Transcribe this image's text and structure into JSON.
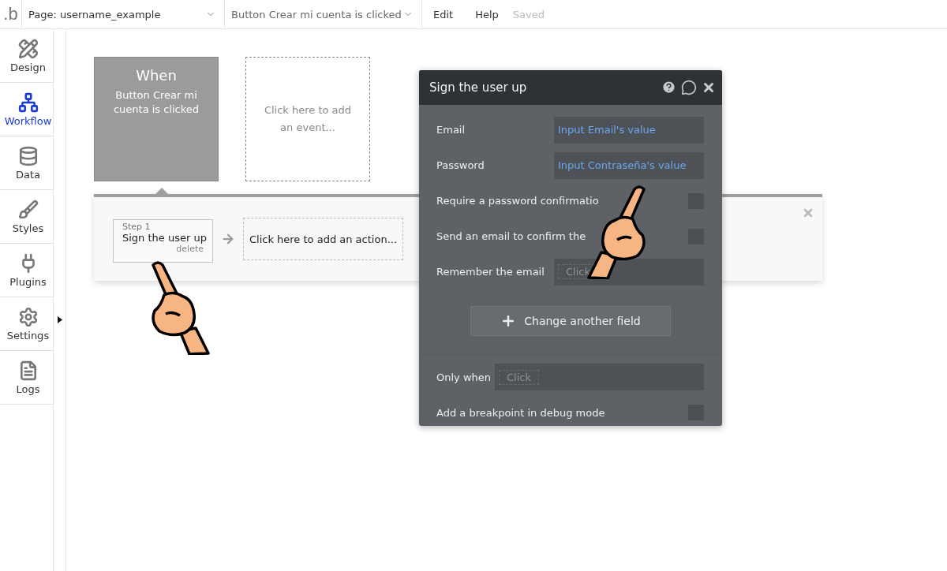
{
  "topbar": {
    "logo": ".b",
    "page_selector": "Page: username_example",
    "event_selector": "Button Crear mi cuenta is clicked",
    "menu": [
      "Edit",
      "Help"
    ],
    "status": "Saved"
  },
  "sidebar": {
    "items": [
      {
        "label": "Design",
        "selected": false
      },
      {
        "label": "Workflow",
        "selected": true
      },
      {
        "label": "Data",
        "selected": false
      },
      {
        "label": "Styles",
        "selected": false
      },
      {
        "label": "Plugins",
        "selected": false
      },
      {
        "label": "Settings",
        "selected": false
      },
      {
        "label": "Logs",
        "selected": false
      }
    ]
  },
  "events": [
    {
      "kind": "event",
      "title": "When",
      "text": "Button Crear mi cuenta is clicked"
    },
    {
      "kind": "placeholder",
      "text": "Click here to add an event..."
    }
  ],
  "actions": [
    {
      "kind": "step",
      "step": "Step 1",
      "title": "Sign the user up",
      "link": "delete"
    },
    {
      "kind": "placeholder",
      "text": "Click here to add an action..."
    }
  ],
  "dialog": {
    "title": "Sign the user up",
    "rows": [
      {
        "kind": "field",
        "label": "Email",
        "value": "Input Email's value"
      },
      {
        "kind": "field",
        "label": "Password",
        "value": "Input Contraseña's value"
      },
      {
        "kind": "checkbox",
        "label": "Require a password confirmatio",
        "checked": false
      },
      {
        "kind": "checkbox",
        "label": "Send an email to confirm the",
        "checked": false
      },
      {
        "kind": "dropdown",
        "label": "Remember the email",
        "placeholder": "Click"
      }
    ],
    "add_button": "Change another field",
    "only_when": {
      "label": "Only when",
      "placeholder": "Click"
    },
    "breakpoint": {
      "label": "Add a breakpoint in debug mode",
      "checked": false
    }
  }
}
